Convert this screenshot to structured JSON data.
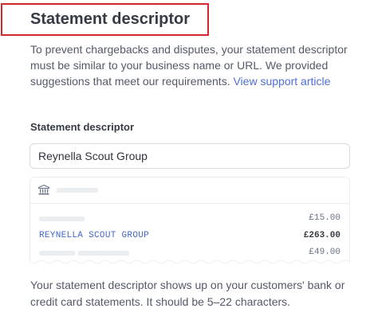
{
  "header": {
    "title": "Statement descriptor"
  },
  "intro": {
    "text": "To prevent chargebacks and disputes, your statement descriptor must be similar to your business name or URL. We provided suggestions that meet our requirements.",
    "link_label": "View support article"
  },
  "form": {
    "field_label": "Statement descriptor",
    "input_value": "Reynella Scout Group"
  },
  "preview": {
    "bank_icon": "bank-icon",
    "rows": [
      {
        "descriptor": "",
        "amount": "£15.00"
      },
      {
        "descriptor": "REYNELLA SCOUT GROUP",
        "amount": "£263.00"
      },
      {
        "descriptor": "",
        "amount": "£49.00"
      }
    ]
  },
  "help": {
    "text": "Your statement descriptor shows up on your customers' bank or credit card statements. It should be 5–22 characters."
  },
  "colors": {
    "highlight_border": "#d0282e",
    "link": "#4f6fd4",
    "descriptor_text": "#4468c8"
  }
}
